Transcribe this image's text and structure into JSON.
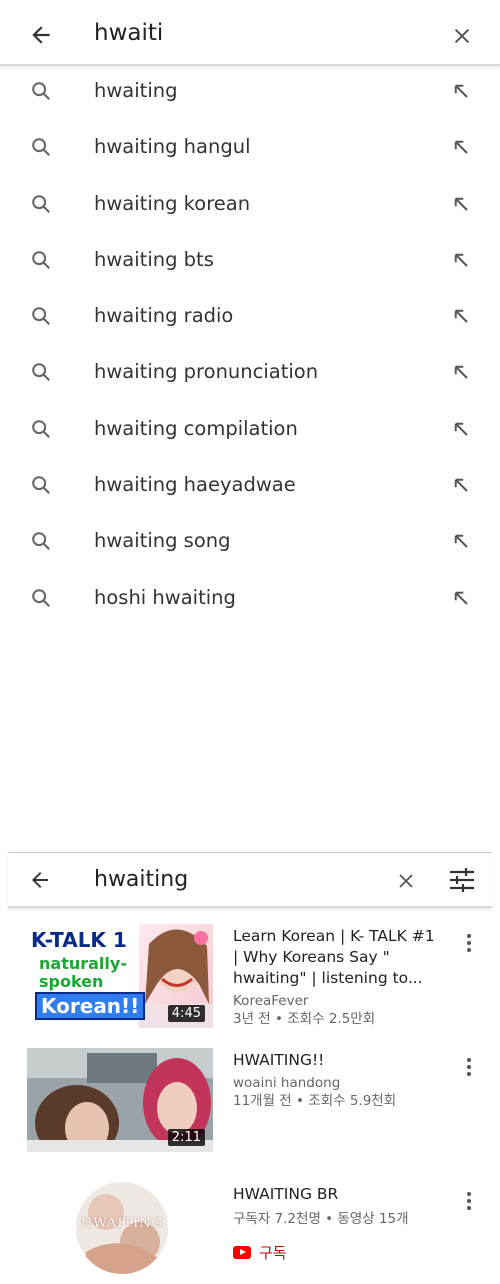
{
  "top": {
    "query": "hwaiti",
    "suggestions": [
      "hwaiting",
      "hwaiting hangul",
      "hwaiting korean",
      "hwaiting bts",
      "hwaiting radio",
      "hwaiting pronunciation",
      "hwaiting compilation",
      "hwaiting haeyadwae",
      "hwaiting song",
      "hoshi hwaiting"
    ]
  },
  "bottom": {
    "query": "hwaiting",
    "results": [
      {
        "title": "Learn Korean | K- TALK #1 | Why Koreans Say \" hwaiting\" | listening to...",
        "channel": "KoreaFever",
        "meta": "3년 전 • 조회수 2.5만회",
        "duration": "4:45",
        "thumb_text": [
          "K-TALK 1",
          "naturally-",
          "spoken",
          "Korean!!"
        ]
      },
      {
        "title": "HWAITING!!",
        "channel": "woaini handong",
        "meta": "11개월 전 • 조회수 5.9천회",
        "duration": "2:11"
      },
      {
        "title": "HWAITING BR",
        "meta": "구독자 7.2천명 • 동영상 15개",
        "subscribe": "구독",
        "avatar_text": "HWAITING"
      }
    ]
  },
  "colors": {
    "accent_red": "#cc0000",
    "divider": "#d8d8d8"
  }
}
